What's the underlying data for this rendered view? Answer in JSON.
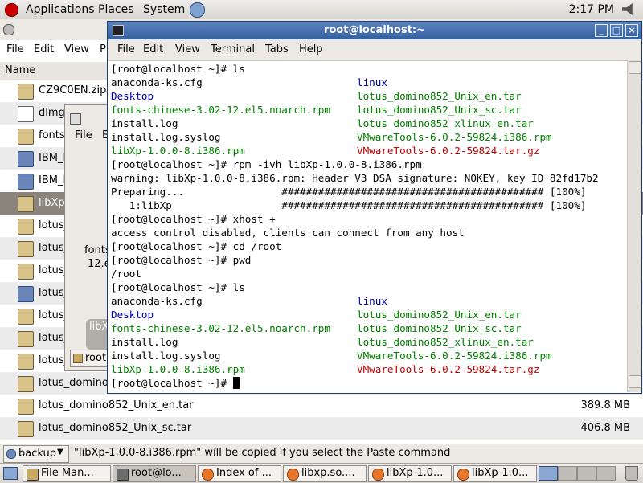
{
  "top_panel": {
    "applications": "Applications",
    "places": "Places",
    "system": "System",
    "clock": "2:17 PM"
  },
  "file_manager": {
    "menu": [
      "File",
      "Edit",
      "View",
      "Pl"
    ],
    "column_name": "Name",
    "rows": [
      {
        "name": "CZ9C0EN.zip",
        "size": ""
      },
      {
        "name": "dlmg",
        "size": ""
      },
      {
        "name": "fonts",
        "size": ""
      },
      {
        "name": "IBM_L",
        "size": ""
      },
      {
        "name": "IBM_L",
        "size": ""
      },
      {
        "name": "libXp",
        "size": ""
      },
      {
        "name": "lotus_",
        "size": ""
      },
      {
        "name": "lotus_",
        "size": ""
      },
      {
        "name": "lotus_",
        "size": ""
      },
      {
        "name": "lotus_",
        "size": ""
      },
      {
        "name": "lotus_",
        "size": ""
      },
      {
        "name": "lotus_",
        "size": ""
      },
      {
        "name": "lotus_domino",
        "size": ""
      },
      {
        "name": "lotus_domino852_Unix_en.tar",
        "size": "389.8 MB"
      },
      {
        "name": "lotus_domino852_Unix_sc.tar",
        "size": "406.8 MB"
      }
    ]
  },
  "small_window": {
    "menu_file": "File",
    "menu_edit": "E",
    "label_1": "fonts",
    "label_2": "12.e",
    "bubble": "libX",
    "crumb": "root"
  },
  "terminal": {
    "title": "root@localhost:~",
    "menu": [
      "File",
      "Edit",
      "View",
      "Terminal",
      "Tabs",
      "Help"
    ],
    "lines": [
      {
        "left": "[root@localhost ~]# ls",
        "right": ""
      },
      {
        "left": "anaconda-ks.cfg",
        "right": "linux"
      },
      {
        "left": "Desktop",
        "right": "lotus_domino852_Unix_en.tar"
      },
      {
        "left": "fonts-chinese-3.02-12.el5.noarch.rpm",
        "right": "lotus_domino852_Unix_sc.tar"
      },
      {
        "left": "install.log",
        "right": "lotus_domino852_xlinux_en.tar"
      },
      {
        "left": "install.log.syslog",
        "right": "VMwareTools-6.0.2-59824.i386.rpm"
      },
      {
        "left": "libXp-1.0.0-8.i386.rpm",
        "right": "VMwareTools-6.0.2-59824.tar.gz"
      },
      {
        "left": "[root@localhost ~]# rpm -ivh libXp-1.0.0-8.i386.rpm",
        "right": ""
      },
      {
        "left": "warning: libXp-1.0.0-8.i386.rpm: Header V3 DSA signature: NOKEY, key ID 82fd17b2",
        "right": ""
      },
      {
        "left": "Preparing...                ########################################### [100%]",
        "right": ""
      },
      {
        "left": "   1:libXp                  ########################################### [100%]",
        "right": ""
      },
      {
        "left": "[root@localhost ~]# xhost +",
        "right": ""
      },
      {
        "left": "access control disabled, clients can connect from any host",
        "right": ""
      },
      {
        "left": "[root@localhost ~]# cd /root",
        "right": ""
      },
      {
        "left": "[root@localhost ~]# pwd",
        "right": ""
      },
      {
        "left": "/root",
        "right": ""
      },
      {
        "left": "[root@localhost ~]# ls",
        "right": ""
      },
      {
        "left": "anaconda-ks.cfg",
        "right": "linux"
      },
      {
        "left": "Desktop",
        "right": "lotus_domino852_Unix_en.tar"
      },
      {
        "left": "fonts-chinese-3.02-12.el5.noarch.rpm",
        "right": "lotus_domino852_Unix_sc.tar"
      },
      {
        "left": "install.log",
        "right": "lotus_domino852_xlinux_en.tar"
      },
      {
        "left": "install.log.syslog",
        "right": "VMwareTools-6.0.2-59824.i386.rpm"
      },
      {
        "left": "libXp-1.0.0-8.i386.rpm",
        "right": "VMwareTools-6.0.2-59824.tar.gz"
      },
      {
        "left": "[root@localhost ~]# ",
        "right": ""
      }
    ]
  },
  "statusbar": {
    "location_button": "backup",
    "message": "\"libXp-1.0.0-8.i386.rpm\" will be copied if you select the Paste command"
  },
  "taskbar": {
    "tasks": [
      "File Man...",
      "root@lo...",
      "Index of ...",
      "libxp.so....",
      "libXp-1.0...",
      "libXp-1.0..."
    ]
  },
  "colors": {
    "title_bar": "#335f9e",
    "directory": "#0000c8",
    "rpm_file": "#008000",
    "archive_file": "#c00000"
  }
}
